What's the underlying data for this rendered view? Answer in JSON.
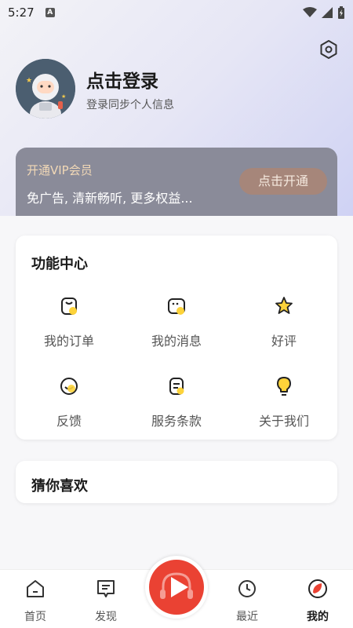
{
  "status_bar": {
    "time": "5:27",
    "notification_letter": "A"
  },
  "profile": {
    "login_title": "点击登录",
    "login_subtitle": "登录同步个人信息"
  },
  "vip": {
    "title": "开通VIP会员",
    "description": "免广告, 清新畅听, 更多权益...",
    "button_label": "点击开通"
  },
  "function_center": {
    "title": "功能中心",
    "items": [
      {
        "label": "我的订单",
        "icon": "order-icon"
      },
      {
        "label": "我的消息",
        "icon": "message-icon"
      },
      {
        "label": "好评",
        "icon": "star-icon"
      },
      {
        "label": "反馈",
        "icon": "feedback-icon"
      },
      {
        "label": "服务条款",
        "icon": "terms-icon"
      },
      {
        "label": "关于我们",
        "icon": "lightbulb-icon"
      }
    ]
  },
  "recommend": {
    "title": "猜你喜欢"
  },
  "tabbar": {
    "tabs": [
      {
        "label": "首页",
        "icon": "home-icon"
      },
      {
        "label": "发现",
        "icon": "discover-icon"
      },
      {
        "label": "最近",
        "icon": "clock-icon"
      },
      {
        "label": "我的",
        "icon": "profile-icon",
        "active": true
      }
    ],
    "center_button_icon": "play-icon"
  },
  "colors": {
    "accent_red": "#ea4233",
    "accent_yellow": "#fdd33a",
    "vip_gold": "#f1d8b6",
    "vip_card": "#8a8b99",
    "vip_button": "#a6867a"
  }
}
